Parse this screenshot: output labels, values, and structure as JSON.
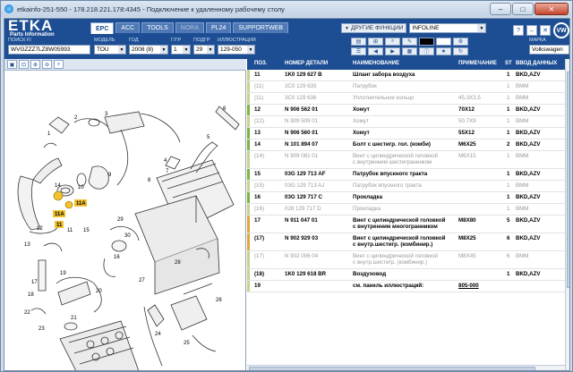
{
  "window": {
    "title": "etkainfo-251-550 - 178.218.221.178:4345 - Подключение к удаленному рабочему столу",
    "minimize": "–",
    "maximize": "□",
    "close": "✕"
  },
  "app": {
    "logo_big": "ETKA",
    "logo_small": "Parts Information",
    "tabs": [
      "EPC",
      "ACC",
      "TOOLS",
      "NORA",
      "PL24",
      "SUPPORTWEB"
    ],
    "active_tab": "EPC",
    "other_functions_label": "ДРУГИЕ ФУНКЦИИ",
    "infoline_value": "INFOLINE",
    "corner_buttons": [
      "?",
      "–",
      "✕"
    ],
    "brand_logo": "VW"
  },
  "fields": {
    "search_fi": {
      "label": "ПОИСК FI",
      "value": "WVGZZZ7LZ8W05993"
    },
    "model": {
      "label": "МОДЕЛЬ",
      "value": "TOU"
    },
    "year": {
      "label": "ГОД",
      "value": "2008 (8)"
    },
    "group": {
      "label": "Г/ГР",
      "value": "1"
    },
    "subgroup": {
      "label": "ПОДГР",
      "value": "29"
    },
    "illustration": {
      "label": "ИЛЛЮСТРАЦИЯ",
      "value": "129-050"
    },
    "brand": {
      "label": "МАРКА",
      "value": "Volkswagen"
    }
  },
  "table": {
    "columns": [
      "ПОЗ.",
      "НОМЕР ДЕТАЛИ",
      "НАИМЕНОВАНИЕ",
      "ПРИМЕЧАНИЕ",
      "ST",
      "ВВОД ДАННЫХ"
    ],
    "rows": [
      {
        "pos": "11",
        "part": "1K0  129  627  B",
        "name": "Шланг забора воздуха",
        "note": "",
        "st": "1",
        "data": "BKD,AZV",
        "style": "hdr",
        "marker": "#c8d28a"
      },
      {
        "pos": "(11)",
        "part": "3C0  129  635",
        "name": "Патрубок",
        "note": "",
        "st": "1",
        "data": "BMM",
        "style": "sub",
        "marker": "#c8d28a"
      },
      {
        "pos": "(11)",
        "part": "3C0  129  636",
        "name": "Уплотнительное кольцо",
        "note": "45,3X3,5",
        "st": "1",
        "data": "BMM",
        "style": "sub",
        "marker": "#c8d28a"
      },
      {
        "pos": "12",
        "part": "N     906  562  01",
        "name": "Хомут",
        "note": "70X12",
        "st": "1",
        "data": "BKD,AZV",
        "style": "hdr",
        "marker": "#7fb33b"
      },
      {
        "pos": "(12)",
        "part": "N     909  509  01",
        "name": "Хомут",
        "note": "50.7X9",
        "st": "1",
        "data": "BMM",
        "style": "sub",
        "marker": "#c8d28a"
      },
      {
        "pos": "13",
        "part": "N     906  560  01",
        "name": "Хомут",
        "note": "55X12",
        "st": "1",
        "data": "BKD,AZV",
        "style": "hdr",
        "marker": "#7fb33b"
      },
      {
        "pos": "14",
        "part": "N     101  894  07",
        "name": "Болт с шестигр. гол. (комби)",
        "note": "M6X25",
        "st": "2",
        "data": "BKD,AZV",
        "style": "hdr",
        "marker": "#7fb33b"
      },
      {
        "pos": "(14)",
        "part": "N     909  081  01",
        "name": "Винт с цилиндрической головкой",
        "name2": "с внутренним шестигранником",
        "note": "M6X15",
        "st": "1",
        "data": "BMM",
        "style": "sub",
        "marker": "#c8d28a",
        "tall": true
      },
      {
        "pos": "15",
        "part": "03G  129  713  AF",
        "name": "Патрубок впускного тракта",
        "note": "",
        "st": "1",
        "data": "BKD,AZV",
        "style": "hdr",
        "marker": "#7fb33b"
      },
      {
        "pos": "(15)",
        "part": "03G  129  713  AJ",
        "name": "Патрубок впускного тракта",
        "note": "",
        "st": "1",
        "data": "BMM",
        "style": "sub",
        "marker": "#c8d28a"
      },
      {
        "pos": "16",
        "part": "03G  129  717  C",
        "name": "Прокладка",
        "note": "",
        "st": "1",
        "data": "BKD,AZV",
        "style": "hdr",
        "marker": "#7fb33b"
      },
      {
        "pos": "(16)",
        "part": "028  129  717  D",
        "name": "Прокладка",
        "note": "",
        "st": "1",
        "data": "BMM",
        "style": "sub",
        "marker": "#c8d28a"
      },
      {
        "pos": "17",
        "part": "N     911  047  01",
        "name": "Винт с цилиндрической головкой",
        "name2": "с внутренним многогранником",
        "note": "M8X80",
        "st": "5",
        "data": "BKD,AZV",
        "style": "hdr",
        "marker": "#e0a93a",
        "tall": true
      },
      {
        "pos": "(17)",
        "part": "N     902  929  03",
        "name": "Винт с цилиндрической головкой",
        "name2": "с внутр.шестигр. (комбинир.)",
        "note": "M8X25",
        "st": "6",
        "data": "BKD,AZV",
        "style": "hdr",
        "marker": "#e0a93a",
        "tall": true
      },
      {
        "pos": "(17)",
        "part": "N     902  006  04",
        "name": "Винт с цилиндрической головкой",
        "name2": "с внутр.шестигр. (комбинир.)",
        "note": "M8X45",
        "st": "6",
        "data": "BMM",
        "style": "sub",
        "marker": "#c8d28a",
        "tall": true
      },
      {
        "pos": "(18)",
        "part": "1K0  129  618  BR",
        "name": "Воздуховод",
        "note": "",
        "st": "1",
        "data": "BKD,AZV",
        "style": "hdr",
        "marker": "#c8d28a"
      },
      {
        "pos": "19",
        "part": "",
        "name": "см. панель иллюстраций:",
        "note": "805-000",
        "st": "",
        "data": "",
        "style": "hdr",
        "marker": "#c8d28a"
      }
    ]
  }
}
